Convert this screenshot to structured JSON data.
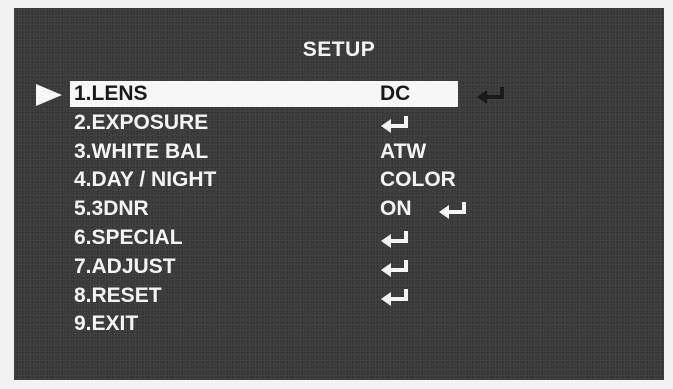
{
  "menu": {
    "title": "SETUP",
    "items": [
      {
        "label": "1.LENS",
        "value": "DC",
        "enter": true
      },
      {
        "label": "2.EXPOSURE",
        "value": "",
        "enter": true
      },
      {
        "label": "3.WHITE BAL",
        "value": "ATW",
        "enter": false
      },
      {
        "label": "4.DAY / NIGHT",
        "value": "COLOR",
        "enter": false
      },
      {
        "label": "5.3DNR",
        "value": "ON",
        "enter": true
      },
      {
        "label": "6.SPECIAL",
        "value": "",
        "enter": true
      },
      {
        "label": "7.ADJUST",
        "value": "",
        "enter": true
      },
      {
        "label": "8.RESET",
        "value": "",
        "enter": true
      },
      {
        "label": "9.EXIT",
        "value": "",
        "enter": false
      }
    ],
    "selected_index": 0
  },
  "icons": {
    "cursor": "right-triangle-cursor-icon",
    "enter": "enter-return-arrow-icon"
  },
  "colors": {
    "screen_bg": "#3a3a3a",
    "text": "#f4f4f4",
    "highlight_bg": "#f7f7f7",
    "highlight_text": "#1a1a1a"
  }
}
